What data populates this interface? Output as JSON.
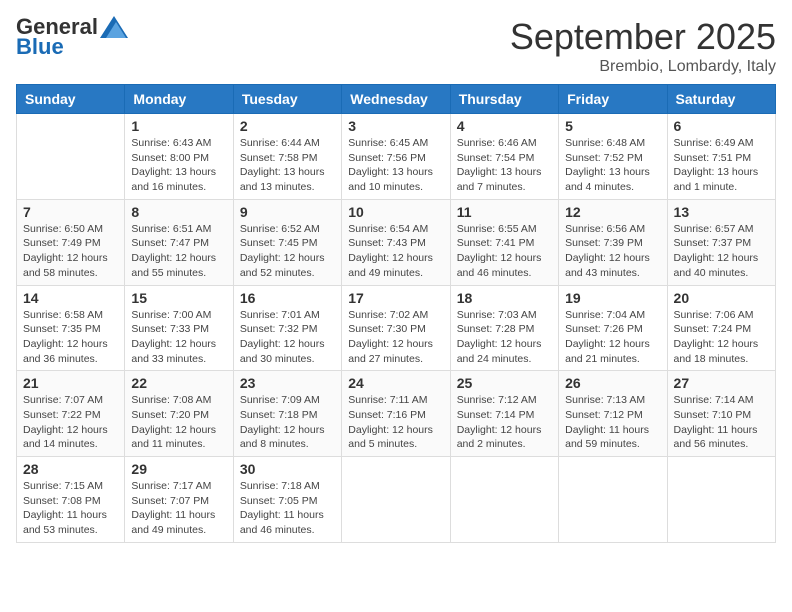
{
  "logo": {
    "general": "General",
    "blue": "Blue"
  },
  "title": "September 2025",
  "subtitle": "Brembio, Lombardy, Italy",
  "days_of_week": [
    "Sunday",
    "Monday",
    "Tuesday",
    "Wednesday",
    "Thursday",
    "Friday",
    "Saturday"
  ],
  "weeks": [
    [
      {
        "day": "",
        "info": ""
      },
      {
        "day": "1",
        "info": "Sunrise: 6:43 AM\nSunset: 8:00 PM\nDaylight: 13 hours\nand 16 minutes."
      },
      {
        "day": "2",
        "info": "Sunrise: 6:44 AM\nSunset: 7:58 PM\nDaylight: 13 hours\nand 13 minutes."
      },
      {
        "day": "3",
        "info": "Sunrise: 6:45 AM\nSunset: 7:56 PM\nDaylight: 13 hours\nand 10 minutes."
      },
      {
        "day": "4",
        "info": "Sunrise: 6:46 AM\nSunset: 7:54 PM\nDaylight: 13 hours\nand 7 minutes."
      },
      {
        "day": "5",
        "info": "Sunrise: 6:48 AM\nSunset: 7:52 PM\nDaylight: 13 hours\nand 4 minutes."
      },
      {
        "day": "6",
        "info": "Sunrise: 6:49 AM\nSunset: 7:51 PM\nDaylight: 13 hours\nand 1 minute."
      }
    ],
    [
      {
        "day": "7",
        "info": "Sunrise: 6:50 AM\nSunset: 7:49 PM\nDaylight: 12 hours\nand 58 minutes."
      },
      {
        "day": "8",
        "info": "Sunrise: 6:51 AM\nSunset: 7:47 PM\nDaylight: 12 hours\nand 55 minutes."
      },
      {
        "day": "9",
        "info": "Sunrise: 6:52 AM\nSunset: 7:45 PM\nDaylight: 12 hours\nand 52 minutes."
      },
      {
        "day": "10",
        "info": "Sunrise: 6:54 AM\nSunset: 7:43 PM\nDaylight: 12 hours\nand 49 minutes."
      },
      {
        "day": "11",
        "info": "Sunrise: 6:55 AM\nSunset: 7:41 PM\nDaylight: 12 hours\nand 46 minutes."
      },
      {
        "day": "12",
        "info": "Sunrise: 6:56 AM\nSunset: 7:39 PM\nDaylight: 12 hours\nand 43 minutes."
      },
      {
        "day": "13",
        "info": "Sunrise: 6:57 AM\nSunset: 7:37 PM\nDaylight: 12 hours\nand 40 minutes."
      }
    ],
    [
      {
        "day": "14",
        "info": "Sunrise: 6:58 AM\nSunset: 7:35 PM\nDaylight: 12 hours\nand 36 minutes."
      },
      {
        "day": "15",
        "info": "Sunrise: 7:00 AM\nSunset: 7:33 PM\nDaylight: 12 hours\nand 33 minutes."
      },
      {
        "day": "16",
        "info": "Sunrise: 7:01 AM\nSunset: 7:32 PM\nDaylight: 12 hours\nand 30 minutes."
      },
      {
        "day": "17",
        "info": "Sunrise: 7:02 AM\nSunset: 7:30 PM\nDaylight: 12 hours\nand 27 minutes."
      },
      {
        "day": "18",
        "info": "Sunrise: 7:03 AM\nSunset: 7:28 PM\nDaylight: 12 hours\nand 24 minutes."
      },
      {
        "day": "19",
        "info": "Sunrise: 7:04 AM\nSunset: 7:26 PM\nDaylight: 12 hours\nand 21 minutes."
      },
      {
        "day": "20",
        "info": "Sunrise: 7:06 AM\nSunset: 7:24 PM\nDaylight: 12 hours\nand 18 minutes."
      }
    ],
    [
      {
        "day": "21",
        "info": "Sunrise: 7:07 AM\nSunset: 7:22 PM\nDaylight: 12 hours\nand 14 minutes."
      },
      {
        "day": "22",
        "info": "Sunrise: 7:08 AM\nSunset: 7:20 PM\nDaylight: 12 hours\nand 11 minutes."
      },
      {
        "day": "23",
        "info": "Sunrise: 7:09 AM\nSunset: 7:18 PM\nDaylight: 12 hours\nand 8 minutes."
      },
      {
        "day": "24",
        "info": "Sunrise: 7:11 AM\nSunset: 7:16 PM\nDaylight: 12 hours\nand 5 minutes."
      },
      {
        "day": "25",
        "info": "Sunrise: 7:12 AM\nSunset: 7:14 PM\nDaylight: 12 hours\nand 2 minutes."
      },
      {
        "day": "26",
        "info": "Sunrise: 7:13 AM\nSunset: 7:12 PM\nDaylight: 11 hours\nand 59 minutes."
      },
      {
        "day": "27",
        "info": "Sunrise: 7:14 AM\nSunset: 7:10 PM\nDaylight: 11 hours\nand 56 minutes."
      }
    ],
    [
      {
        "day": "28",
        "info": "Sunrise: 7:15 AM\nSunset: 7:08 PM\nDaylight: 11 hours\nand 53 minutes."
      },
      {
        "day": "29",
        "info": "Sunrise: 7:17 AM\nSunset: 7:07 PM\nDaylight: 11 hours\nand 49 minutes."
      },
      {
        "day": "30",
        "info": "Sunrise: 7:18 AM\nSunset: 7:05 PM\nDaylight: 11 hours\nand 46 minutes."
      },
      {
        "day": "",
        "info": ""
      },
      {
        "day": "",
        "info": ""
      },
      {
        "day": "",
        "info": ""
      },
      {
        "day": "",
        "info": ""
      }
    ]
  ]
}
